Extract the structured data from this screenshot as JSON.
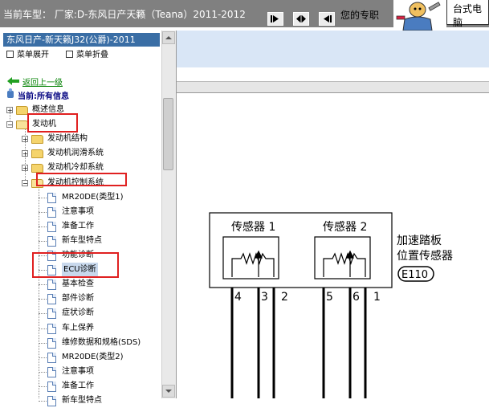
{
  "header": {
    "vehicle_label": "当前车型： 厂家:D-东风日产天籁（Teana）2011-2012",
    "expert_text": "您的专职",
    "ad_text": "台式电脑"
  },
  "nav": {
    "buttons": [
      {
        "icon": "arrow-right-icon"
      },
      {
        "icon": "double-arrow-icon"
      },
      {
        "icon": "arrow-left-icon"
      }
    ]
  },
  "tree": {
    "title": "东风日产-新天籁J32(公爵)-2011",
    "expand_all": "菜单展开",
    "collapse_all": "菜单折叠",
    "back": "返回上一级",
    "current": "当前:所有信息",
    "items": [
      {
        "label": "概述信息",
        "type": "folder",
        "level": 0
      },
      {
        "label": "发动机",
        "type": "folder-open",
        "level": 0
      },
      {
        "label": "发动机结构",
        "type": "folder",
        "level": 1
      },
      {
        "label": "发动机润滑系统",
        "type": "folder",
        "level": 1
      },
      {
        "label": "发动机冷却系统",
        "type": "folder",
        "level": 1
      },
      {
        "label": "发动机控制系统",
        "type": "folder-open",
        "level": 1
      },
      {
        "label": "MR20DE(类型1)",
        "type": "page",
        "level": 2
      },
      {
        "label": "注意事项",
        "type": "page",
        "level": 2
      },
      {
        "label": "准备工作",
        "type": "page",
        "level": 2
      },
      {
        "label": "新车型特点",
        "type": "page",
        "level": 2
      },
      {
        "label": "功能诊断",
        "type": "page",
        "level": 2
      },
      {
        "label": "ECU诊断",
        "type": "page",
        "level": 2
      },
      {
        "label": "基本检查",
        "type": "page",
        "level": 2
      },
      {
        "label": "部件诊断",
        "type": "page",
        "level": 2
      },
      {
        "label": "症状诊断",
        "type": "page",
        "level": 2
      },
      {
        "label": "车上保养",
        "type": "page",
        "level": 2
      },
      {
        "label": "维修数据和规格(SDS)",
        "type": "page",
        "level": 2
      },
      {
        "label": "MR20DE(类型2)",
        "type": "page",
        "level": 2
      },
      {
        "label": "注意事项",
        "type": "page",
        "level": 2
      },
      {
        "label": "准备工作",
        "type": "page",
        "level": 2
      },
      {
        "label": "新车型特点",
        "type": "page",
        "level": 2
      }
    ]
  },
  "diagram": {
    "sensor1": "传感器 1",
    "sensor2": "传感器 2",
    "name_line1": "加速踏板",
    "name_line2": "位置传感器",
    "connector": "E110",
    "pins": [
      "4",
      "3",
      "2",
      "5",
      "6",
      "1"
    ]
  },
  "colors": {
    "title_bar": "#3a6ea5",
    "top_bar": "#808080",
    "highlight_box": "#e02020",
    "back_link": "#008000"
  }
}
